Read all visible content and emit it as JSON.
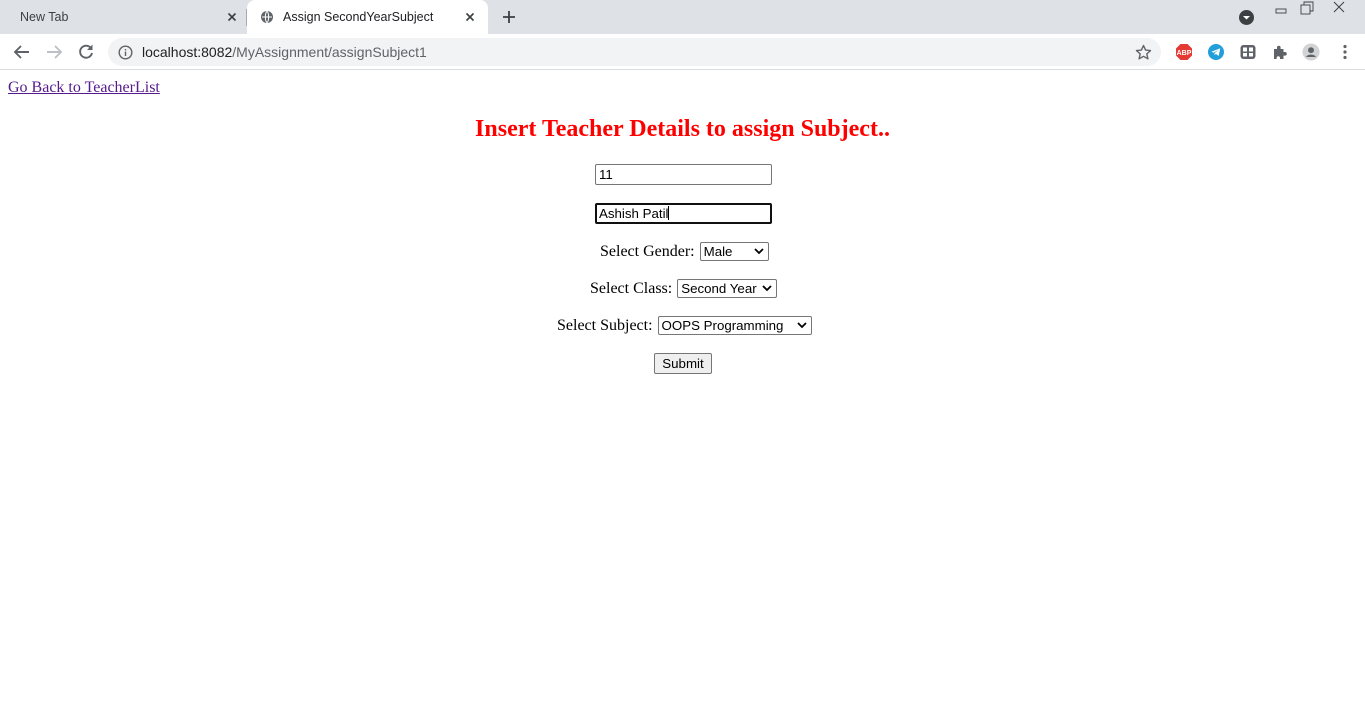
{
  "browser": {
    "tabs": [
      {
        "title": "New Tab",
        "active": false
      },
      {
        "title": "Assign SecondYearSubject",
        "active": true
      }
    ],
    "url_host": "localhost:8082",
    "url_path": "/MyAssignment/assignSubject1",
    "extensions": [
      "abp-icon",
      "telegram-icon",
      "grid-extension-icon",
      "puzzle-icon",
      "profile-icon",
      "menu-dots-icon"
    ],
    "abp_label": "ABP"
  },
  "page": {
    "back_link": "Go Back to TeacherList",
    "heading": "Insert Teacher Details to assign Subject..",
    "heading_color": "#ff0000",
    "teacher_id": "11",
    "teacher_name": "Ashish Patil",
    "gender_label": "Select Gender:",
    "gender_value": "Male",
    "class_label": "Select Class:",
    "class_value": "Second Year",
    "subject_label": "Select Subject:",
    "subject_value": "OOPS Programming",
    "submit_label": "Submit"
  }
}
